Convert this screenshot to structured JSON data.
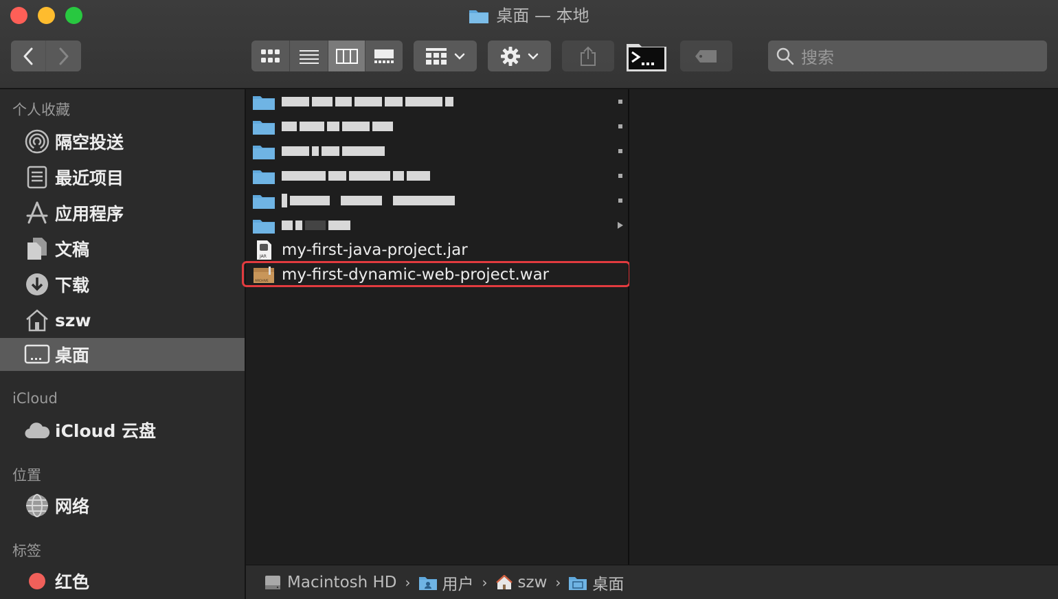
{
  "window": {
    "title": "桌面 — 本地"
  },
  "toolbar": {
    "search_placeholder": "搜索",
    "view_modes": [
      "icon-view",
      "list-view",
      "column-view",
      "gallery-view"
    ],
    "active_view": "column-view"
  },
  "sidebar": {
    "favorites_header": "个人收藏",
    "favorites": [
      {
        "label": "隔空投送",
        "icon": "airdrop-icon"
      },
      {
        "label": "最近项目",
        "icon": "recents-icon"
      },
      {
        "label": "应用程序",
        "icon": "applications-icon"
      },
      {
        "label": "文稿",
        "icon": "documents-icon"
      },
      {
        "label": "下载",
        "icon": "downloads-icon"
      },
      {
        "label": "szw",
        "icon": "home-icon"
      },
      {
        "label": "桌面",
        "icon": "desktop-icon",
        "selected": true
      }
    ],
    "icloud_header": "iCloud",
    "icloud": [
      {
        "label": "iCloud 云盘",
        "icon": "cloud-icon"
      }
    ],
    "locations_header": "位置",
    "locations": [
      {
        "label": "网络",
        "icon": "network-icon"
      }
    ],
    "tags_header": "标签",
    "tags": [
      {
        "label": "红色",
        "color": "#f0605a"
      }
    ]
  },
  "files": {
    "items": [
      {
        "name": "my-first-java-project.jar",
        "kind": "jar"
      },
      {
        "name": "my-first-dynamic-web-project.war",
        "kind": "archive",
        "highlighted": true
      }
    ]
  },
  "pathbar": {
    "crumbs": [
      "Macintosh HD",
      "用户",
      "szw",
      "桌面"
    ]
  },
  "colors": {
    "folder_blue": "#5fa8dc",
    "highlight_red": "#e23b3f",
    "selection_gray": "#5b5b5b"
  }
}
